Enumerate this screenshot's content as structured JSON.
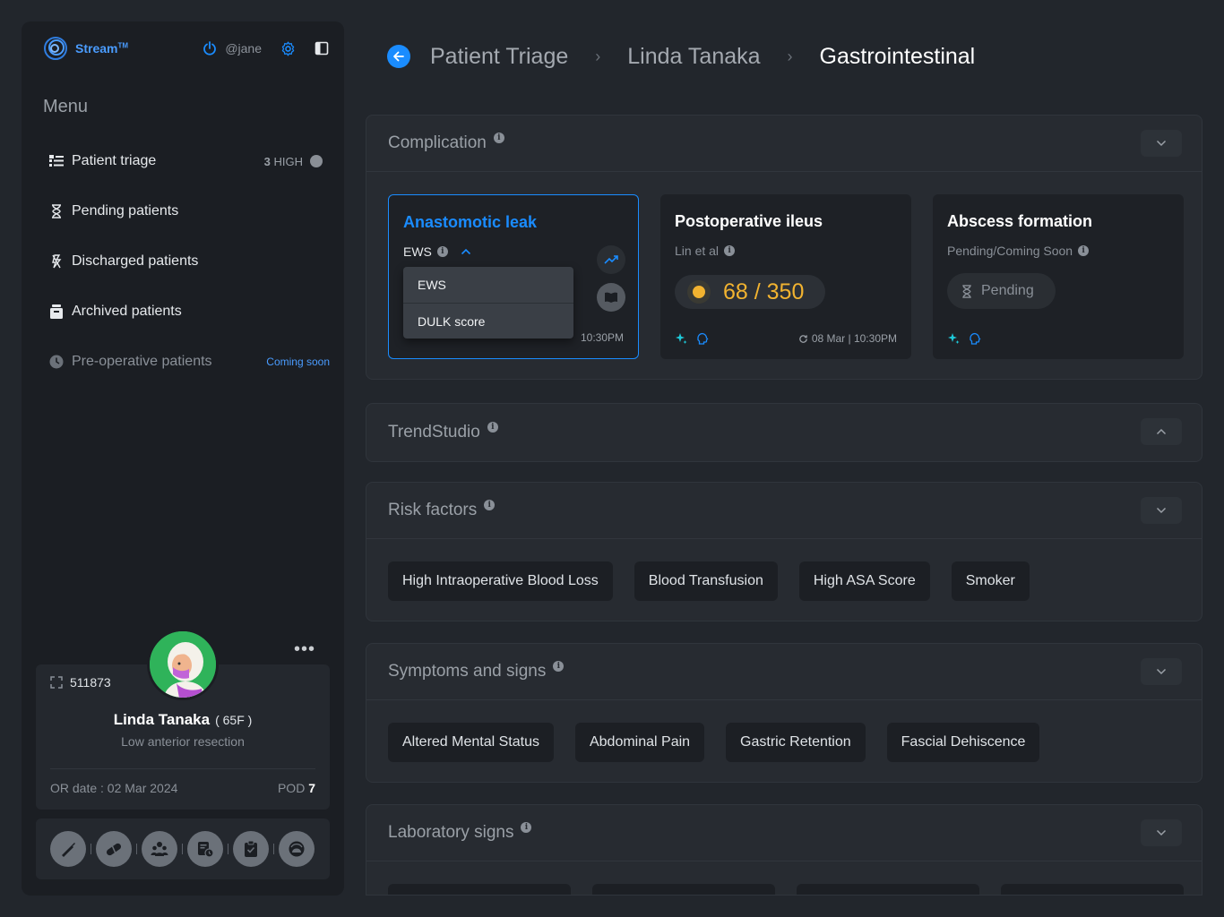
{
  "app": {
    "name": "Stream",
    "trademark": "TM",
    "user": "@jane"
  },
  "colors": {
    "accent": "#1a8cff",
    "score": "#f2b330",
    "background": "#22262c",
    "sidebar": "#1b1e23"
  },
  "sidebar": {
    "menu_title": "Menu",
    "items": [
      {
        "label": "Patient triage",
        "icon": "list-icon",
        "count": "3",
        "badge": "HIGH"
      },
      {
        "label": "Pending patients",
        "icon": "hourglass-icon"
      },
      {
        "label": "Discharged patients",
        "icon": "discharge-icon"
      },
      {
        "label": "Archived patients",
        "icon": "archive-icon"
      },
      {
        "label": "Pre-operative patients",
        "icon": "clock-icon",
        "tag": "Coming soon"
      }
    ],
    "patient": {
      "id": "511873",
      "name": "Linda Tanaka",
      "age_sex": "( 65F )",
      "procedure": "Low anterior resection",
      "or_date": "OR date : 02 Mar 2024",
      "pod_label": "POD",
      "pod_value": "7"
    },
    "tools": [
      "scalpel-icon",
      "pill-icon",
      "team-icon",
      "schedule-icon",
      "clipboard-icon",
      "alarm-icon"
    ]
  },
  "breadcrumb": [
    "Patient Triage",
    "Linda Tanaka",
    "Gastrointestinal"
  ],
  "complication": {
    "title": "Complication",
    "cards": [
      {
        "title": "Anastomotic leak",
        "sub": "EWS",
        "dropdown": [
          "EWS",
          "DULK score"
        ],
        "time": "10:30PM"
      },
      {
        "title": "Postoperative ileus",
        "sub": "Lin et al",
        "score": "68 / 350",
        "score_value": 68,
        "score_max": 350,
        "time": "08 Mar | 10:30PM"
      },
      {
        "title": "Abscess formation",
        "sub": "Pending/Coming Soon",
        "pending": "Pending"
      }
    ]
  },
  "trendstudio": {
    "title": "TrendStudio"
  },
  "risk_factors": {
    "title": "Risk factors",
    "tags": [
      "High Intraoperative Blood Loss",
      "Blood Transfusion",
      "High ASA Score",
      "Smoker"
    ]
  },
  "symptoms": {
    "title": "Symptoms and signs",
    "tags": [
      "Altered Mental Status",
      "Abdominal Pain",
      "Gastric Retention",
      "Fascial Dehiscence"
    ]
  },
  "labs": {
    "title": "Laboratory signs"
  }
}
